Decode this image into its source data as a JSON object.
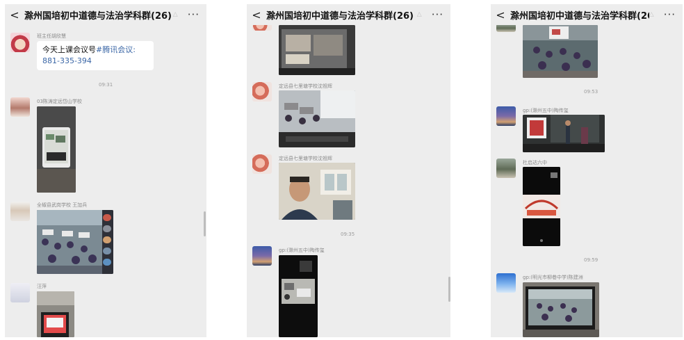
{
  "group_title": "滁州国培初中道德与法治学科群(26)",
  "icons": {
    "back": "chevron-left-icon",
    "mute": "bell-mute-icon",
    "more": "more-dots-icon"
  },
  "colors": {
    "chat_bg": "#ededed",
    "bubble_bg": "#ffffff",
    "link": "#3a66a6"
  },
  "panel1": {
    "msgs": [
      {
        "sender": "班主任胡欣慧",
        "text_before": "今天上课会议号",
        "tag": "#腾讯会议:",
        "number": "881-335-394"
      },
      {
        "time": "09:31"
      },
      {
        "sender": "03陈涛定远岱山学校"
      },
      {
        "sender": "全椒县武岗学校  王加兵"
      },
      {
        "sender": "汪萍"
      }
    ]
  },
  "panel2": {
    "msgs": [
      {
        "sender": "定远县七里塘学校沈祖辉"
      },
      {
        "sender": "定远县七里塘学校沈祖辉"
      },
      {
        "time": "09:35"
      },
      {
        "sender": "gp:(滁州五中)陶传玺"
      }
    ]
  },
  "panel3": {
    "msgs": [
      {
        "time": "09:53"
      },
      {
        "sender": "gp:(滁州五中)陶传玺"
      },
      {
        "sender": "杜启达六中"
      },
      {
        "time": "09:59"
      },
      {
        "sender": "gp:(明光市柳巷中学)陈建洲"
      }
    ]
  }
}
